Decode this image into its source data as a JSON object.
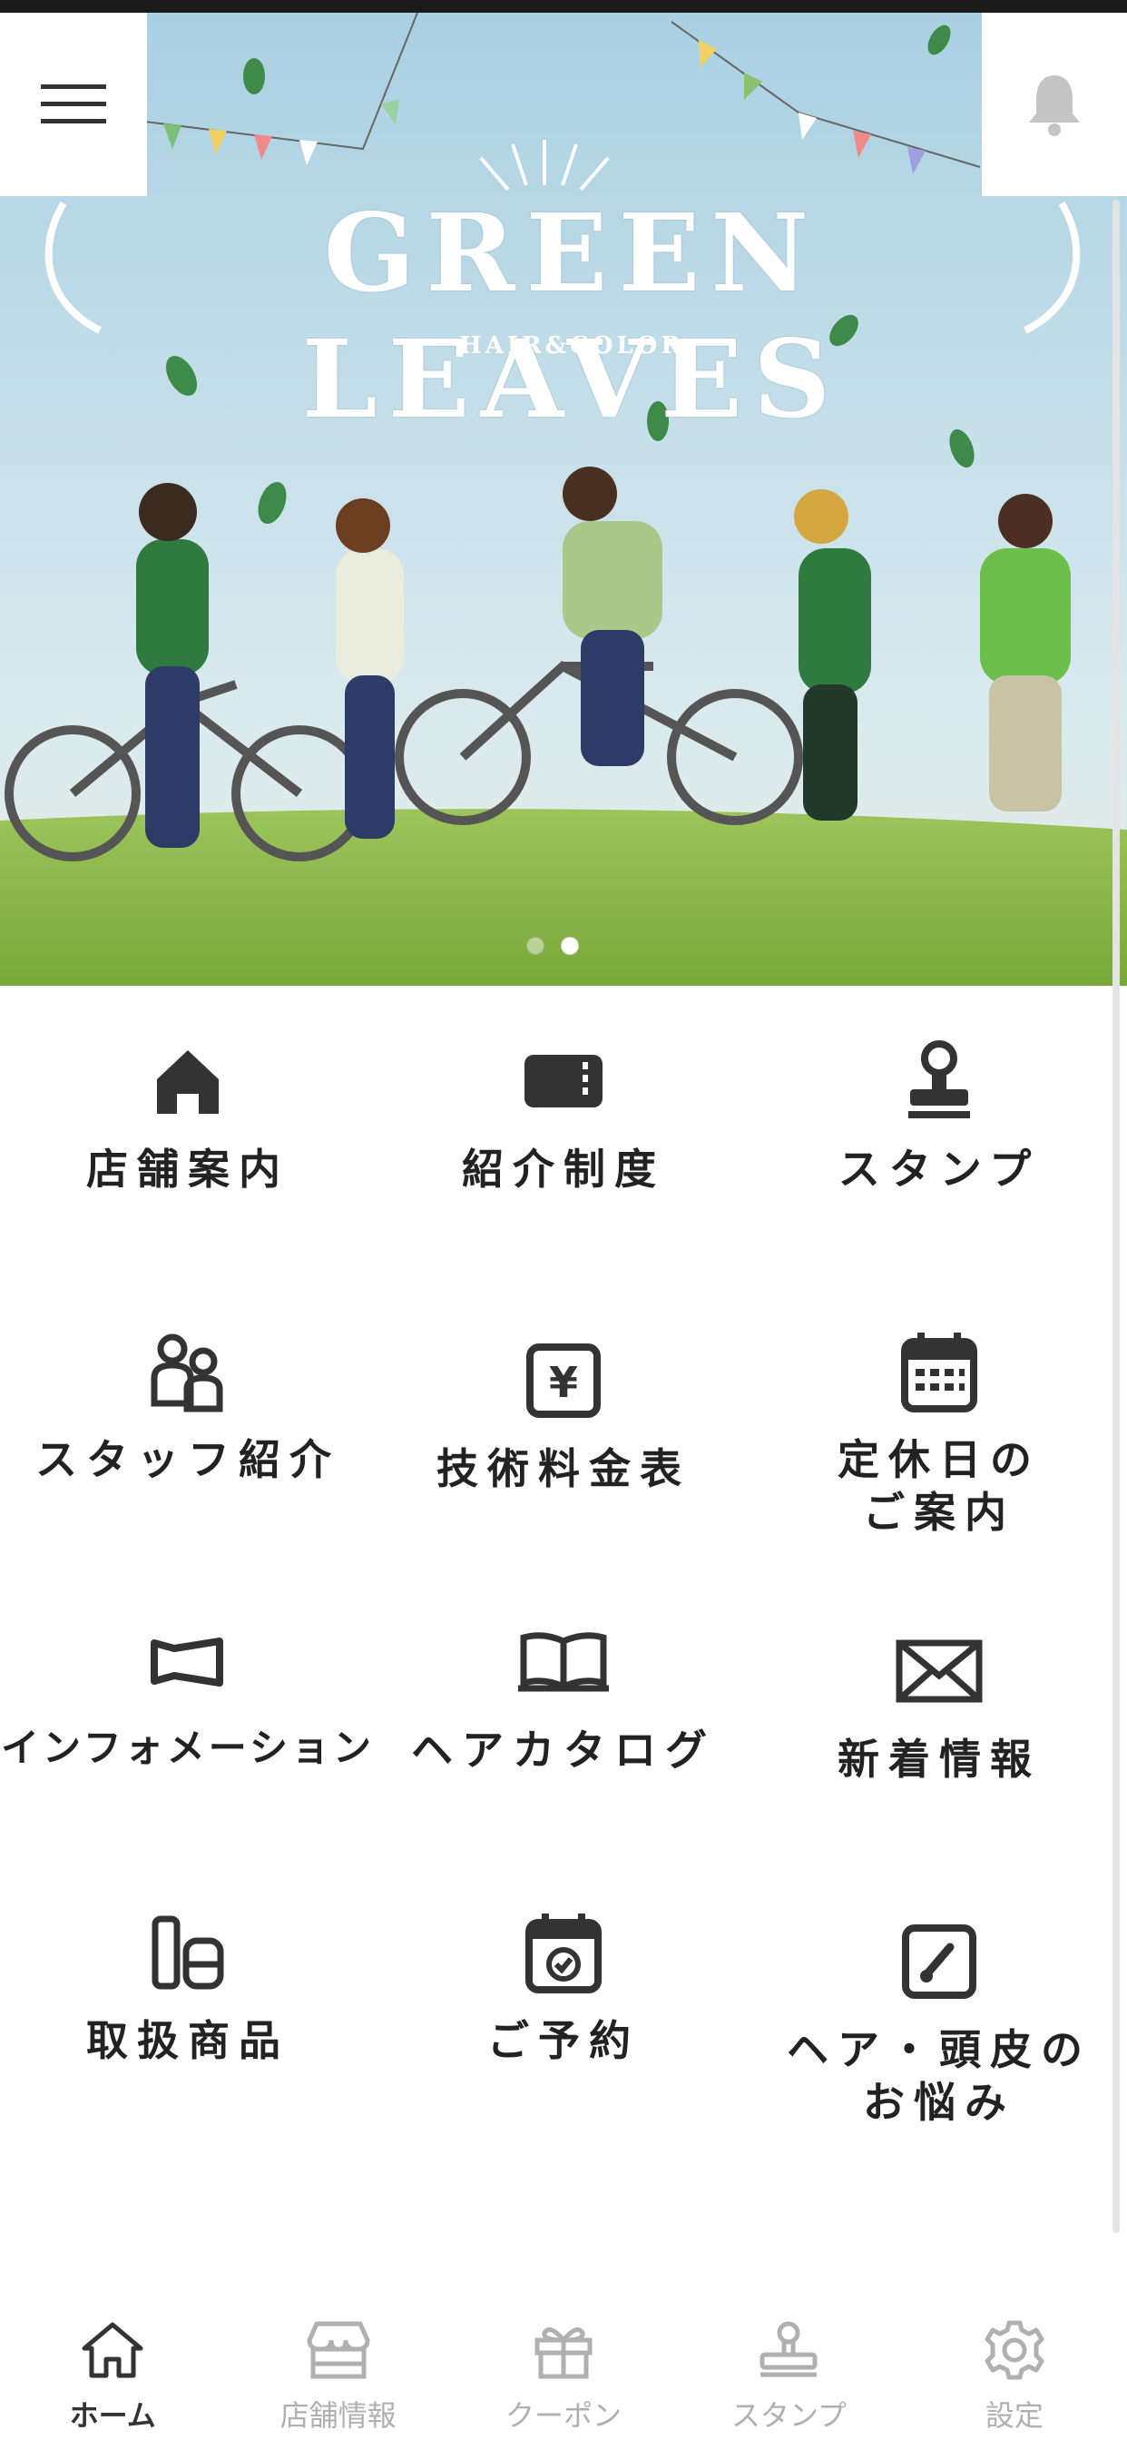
{
  "hero": {
    "title": "GREEN LEAVES",
    "subtitle": "HAIR&COLOR",
    "slides_total": 2,
    "slide_active": 2
  },
  "grid": [
    {
      "name": "store-guide",
      "label": "店舗案内",
      "icon": "home-icon"
    },
    {
      "name": "referral-program",
      "label": "紹介制度",
      "icon": "ticket-icon"
    },
    {
      "name": "stamp",
      "label": "スタンプ",
      "icon": "stamp-icon"
    },
    {
      "name": "staff-intro",
      "label": "スタッフ紹介",
      "icon": "people-icon"
    },
    {
      "name": "price-list",
      "label": "技術料金表",
      "icon": "yen-icon"
    },
    {
      "name": "holiday-info",
      "label": "定休日の\nご案内",
      "icon": "calendar-icon"
    },
    {
      "name": "information",
      "label": "インフォメーション",
      "icon": "megaphone-icon"
    },
    {
      "name": "hair-catalog",
      "label": "ヘアカタログ",
      "icon": "book-icon"
    },
    {
      "name": "news",
      "label": "新着情報",
      "icon": "envelope-icon"
    },
    {
      "name": "products",
      "label": "取扱商品",
      "icon": "bottles-icon"
    },
    {
      "name": "reservation",
      "label": "ご予約",
      "icon": "calendar-check-icon"
    },
    {
      "name": "hair-concerns",
      "label": "ヘア・頭皮の\nお悩み",
      "icon": "note-pencil-icon"
    }
  ],
  "tabbar": [
    {
      "name": "home",
      "label": "ホーム",
      "icon": "home-outline-icon",
      "active": true
    },
    {
      "name": "store-info",
      "label": "店舗情報",
      "icon": "storefront-icon",
      "active": false
    },
    {
      "name": "coupon",
      "label": "クーポン",
      "icon": "gift-icon",
      "active": false
    },
    {
      "name": "stamp",
      "label": "スタンプ",
      "icon": "stamp-outline-icon",
      "active": false
    },
    {
      "name": "settings",
      "label": "設定",
      "icon": "gear-icon",
      "active": false
    }
  ],
  "colors": {
    "icon_dark": "#333333",
    "tab_inactive": "#b0b0b0",
    "sky": "#bcd9e6",
    "grass": "#8ab84a"
  }
}
